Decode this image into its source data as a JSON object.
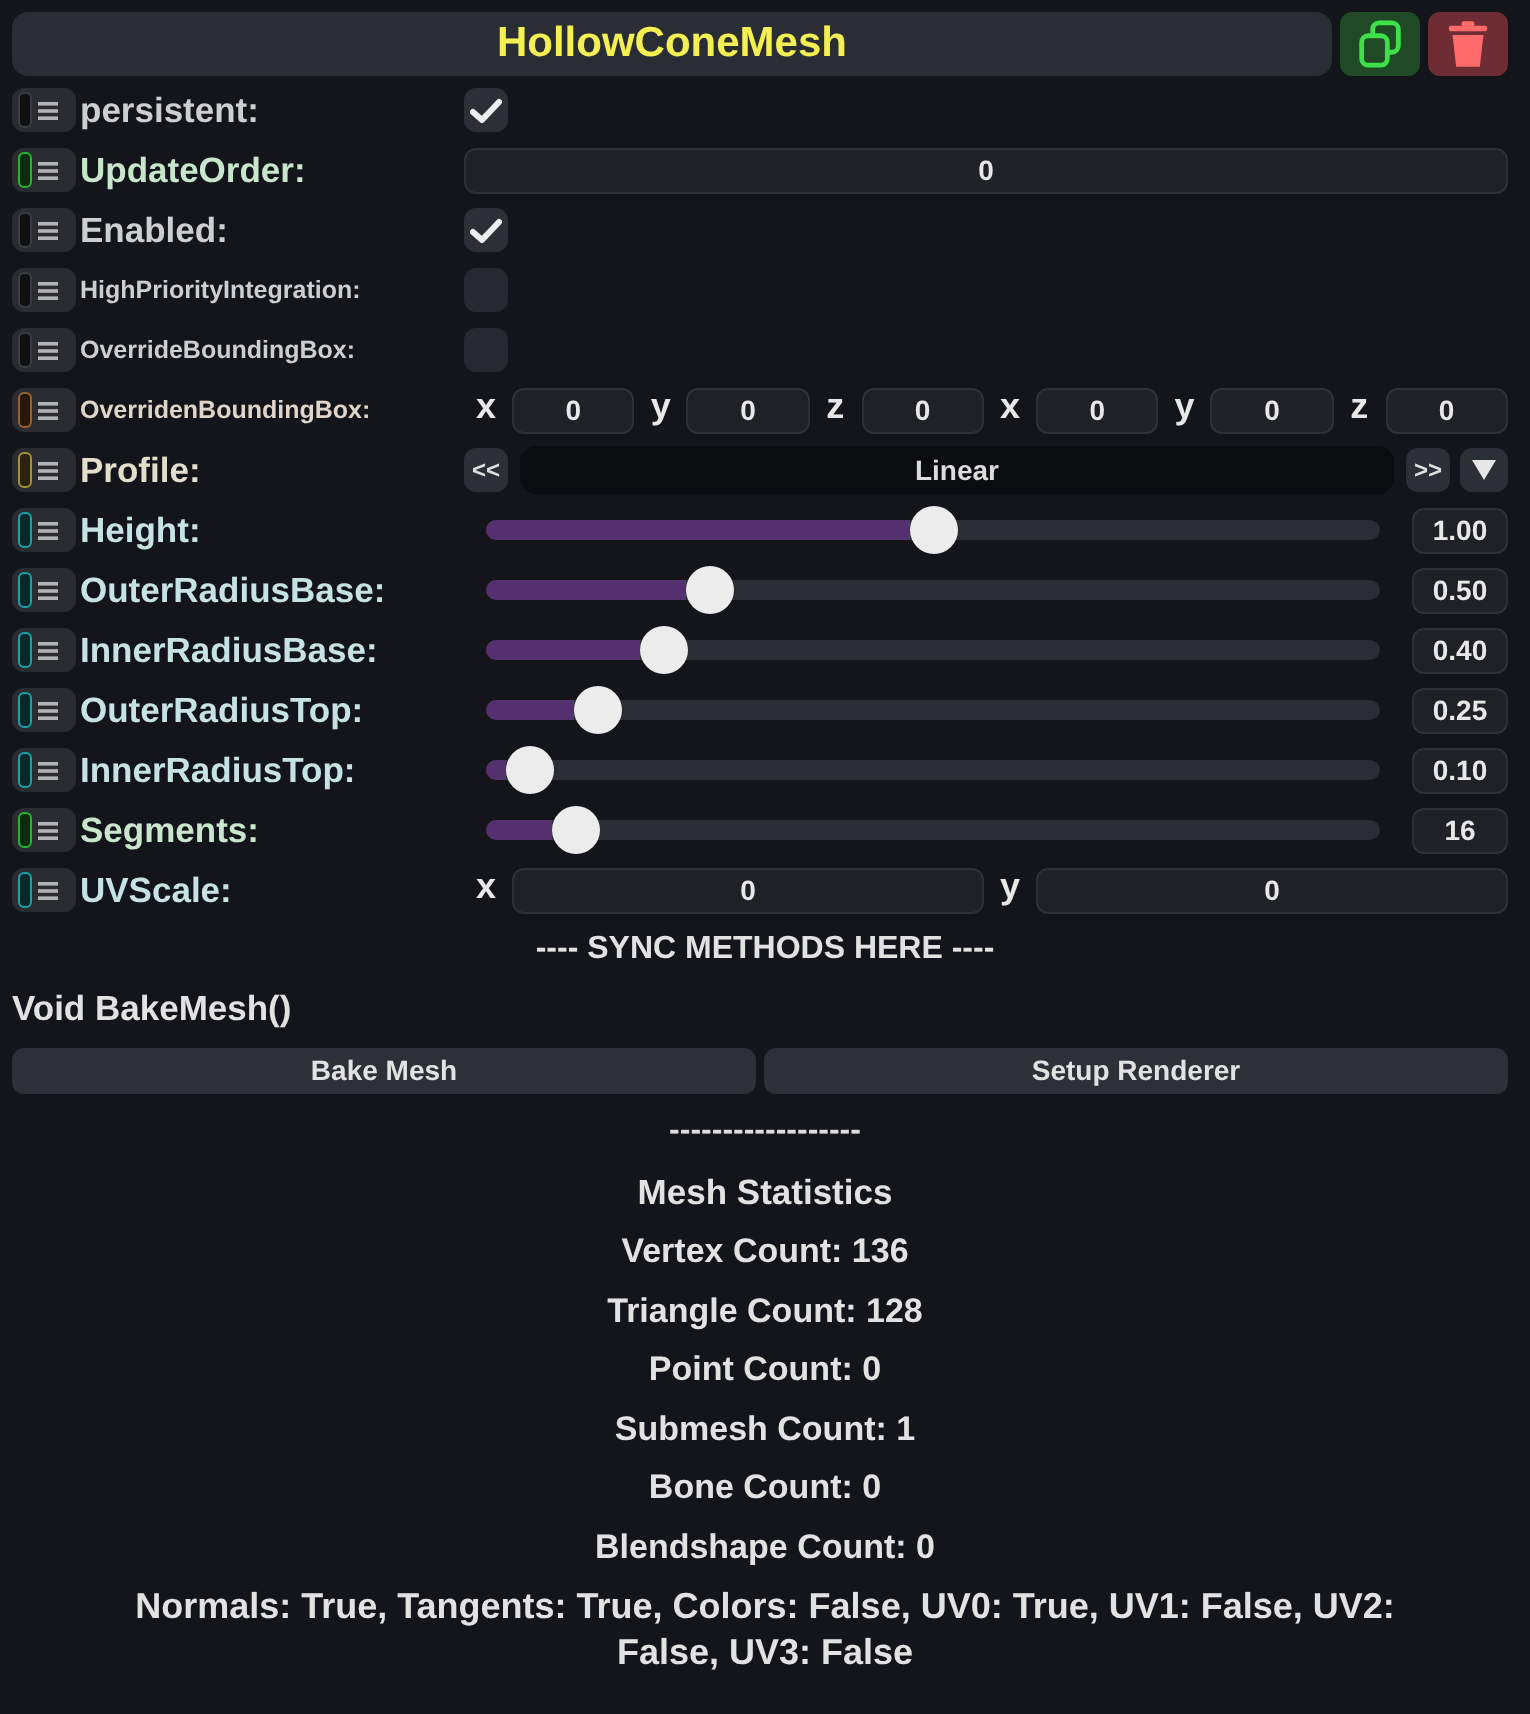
{
  "header": {
    "title": "HollowConeMesh"
  },
  "fields": [
    {
      "label": "persistent:",
      "color": "#3a3d42",
      "kind": "checkbox",
      "checked": true
    },
    {
      "label": "UpdateOrder:",
      "color": "#22b52e",
      "kind": "number",
      "value": "0"
    },
    {
      "label": "Enabled:",
      "color": "#3a3d42",
      "kind": "checkbox",
      "checked": true
    },
    {
      "label": "HighPriorityIntegration:",
      "color": "#3a3d42",
      "kind": "checkbox",
      "checked": false
    },
    {
      "label": "OverrideBoundingBox:",
      "color": "#3a3d42",
      "kind": "checkbox",
      "checked": false
    },
    {
      "label": "OverridenBoundingBox:",
      "color": "#9a6026",
      "kind": "vector",
      "components": [
        {
          "axis": "x",
          "value": "0"
        },
        {
          "axis": "y",
          "value": "0"
        },
        {
          "axis": "z",
          "value": "0"
        },
        {
          "axis": "x",
          "value": "0"
        },
        {
          "axis": "y",
          "value": "0"
        },
        {
          "axis": "z",
          "value": "0"
        }
      ]
    },
    {
      "label": "Profile:",
      "color": "#a88f35",
      "kind": "enum",
      "prev": "<<",
      "value": "Linear",
      "next": ">>"
    },
    {
      "label": "Height:",
      "color": "#16a3a8",
      "kind": "slider",
      "level": 0.5,
      "reading": "1.00"
    },
    {
      "label": "OuterRadiusBase:",
      "color": "#16a3a8",
      "kind": "slider",
      "level": 0.25,
      "reading": "0.50"
    },
    {
      "label": "InnerRadiusBase:",
      "color": "#16a3a8",
      "kind": "slider",
      "level": 0.2,
      "reading": "0.40"
    },
    {
      "label": "OuterRadiusTop:",
      "color": "#16a3a8",
      "kind": "slider",
      "level": 0.125,
      "reading": "0.25"
    },
    {
      "label": "InnerRadiusTop:",
      "color": "#16a3a8",
      "kind": "slider",
      "level": 0.05,
      "reading": "0.10"
    },
    {
      "label": "Segments:",
      "color": "#22b52e",
      "kind": "slider",
      "level": 0.1,
      "reading": "16"
    },
    {
      "label": "UVScale:",
      "color": "#16a3a8",
      "kind": "vector",
      "components": [
        {
          "axis": "x",
          "value": "0"
        },
        {
          "axis": "y",
          "value": "0"
        }
      ]
    }
  ],
  "sync_header": "---- SYNC METHODS HERE ----",
  "method": {
    "signature": "Void BakeMesh()",
    "buttons": [
      "Bake Mesh",
      "Setup Renderer"
    ]
  },
  "separator": "------------------",
  "stats": {
    "title": "Mesh Statistics",
    "lines": [
      "Vertex Count: 136",
      "Triangle Count: 128",
      "Point Count: 0",
      "Submesh Count: 1",
      "Bone Count: 0",
      "Blendshape Count: 0"
    ],
    "summary": "Normals: True, Tangents: True, Colors: False, UV0: True, UV1: False, UV2: False, UV3: False"
  }
}
